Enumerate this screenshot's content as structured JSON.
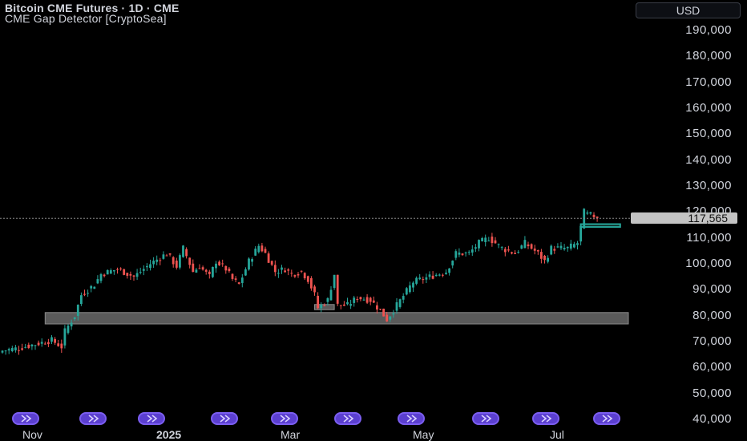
{
  "header": {
    "title": "Bitcoin CME Futures · 1D · CME",
    "indicator": "CME Gap Detector [CryptoSea]"
  },
  "currency_button": "USD",
  "last_price_label": "117,565",
  "colors": {
    "background": "#000000",
    "up": "#26a69a",
    "down": "#ef5350",
    "gap_gray": "#5a5a5a",
    "gap_green": "#26a69a",
    "event_purple": "#5b3fd0"
  },
  "chart_data": {
    "type": "candlestick",
    "title": "Bitcoin CME Futures · 1D · CME",
    "y_ticks": [
      "190,000",
      "180,000",
      "170,000",
      "160,000",
      "150,000",
      "140,000",
      "130,000",
      "120,000",
      "110,000",
      "100,000",
      "90,000",
      "80,000",
      "70,000",
      "60,000",
      "50,000",
      "40,000"
    ],
    "x_ticks": [
      {
        "label": "Nov",
        "bold": false
      },
      {
        "label": "2025",
        "bold": true
      },
      {
        "label": "Mar",
        "bold": false
      },
      {
        "label": "May",
        "bold": false
      },
      {
        "label": "Jul",
        "bold": false
      }
    ],
    "ylim": [
      40000,
      195000
    ],
    "last_price": 117565,
    "close_path": [
      [
        0,
        66500
      ],
      [
        5,
        67500
      ],
      [
        10,
        69000
      ],
      [
        15,
        70500
      ],
      [
        18,
        68000
      ],
      [
        19,
        74000
      ],
      [
        20,
        76000
      ],
      [
        22,
        80000
      ],
      [
        24,
        88000
      ],
      [
        28,
        92000
      ],
      [
        30,
        96000
      ],
      [
        35,
        98000
      ],
      [
        40,
        95000
      ],
      [
        45,
        100000
      ],
      [
        50,
        104000
      ],
      [
        53,
        99000
      ],
      [
        55,
        106000
      ],
      [
        58,
        97000
      ],
      [
        60,
        99000
      ],
      [
        63,
        95000
      ],
      [
        65,
        101000
      ],
      [
        68,
        98000
      ],
      [
        70,
        94000
      ],
      [
        72,
        92000
      ],
      [
        75,
        101000
      ],
      [
        78,
        107000
      ],
      [
        80,
        104000
      ],
      [
        83,
        97000
      ],
      [
        86,
        98000
      ],
      [
        88,
        96000
      ],
      [
        91,
        97000
      ],
      [
        93,
        94000
      ],
      [
        95,
        88000
      ],
      [
        96,
        83000
      ],
      [
        99,
        86000
      ],
      [
        101,
        96000
      ],
      [
        102,
        84000
      ],
      [
        105,
        84000
      ],
      [
        108,
        87000
      ],
      [
        112,
        86000
      ],
      [
        115,
        82000
      ],
      [
        117,
        78500
      ],
      [
        120,
        84000
      ],
      [
        125,
        93000
      ],
      [
        130,
        95000
      ],
      [
        135,
        97000
      ],
      [
        138,
        104000
      ],
      [
        142,
        104000
      ],
      [
        145,
        108000
      ],
      [
        148,
        110000
      ],
      [
        152,
        106000
      ],
      [
        156,
        104000
      ],
      [
        159,
        108000
      ],
      [
        163,
        104000
      ],
      [
        165,
        101000
      ],
      [
        167,
        106000
      ],
      [
        172,
        106000
      ],
      [
        175,
        108000
      ],
      [
        176,
        114000
      ],
      [
        177,
        120000
      ],
      [
        178,
        119000
      ],
      [
        180,
        118500
      ],
      [
        181,
        117565
      ]
    ],
    "gaps": [
      {
        "color": "gray",
        "from_x": 13,
        "to_x": "end",
        "low": 76800,
        "high": 81200
      },
      {
        "color": "gray",
        "from_x": 95,
        "to_x": 101,
        "low": 82300,
        "high": 84300
      },
      {
        "color": "green",
        "from_x": 176,
        "to_x": 188,
        "low": 114200,
        "high": 115300
      }
    ]
  },
  "events_count": 10
}
